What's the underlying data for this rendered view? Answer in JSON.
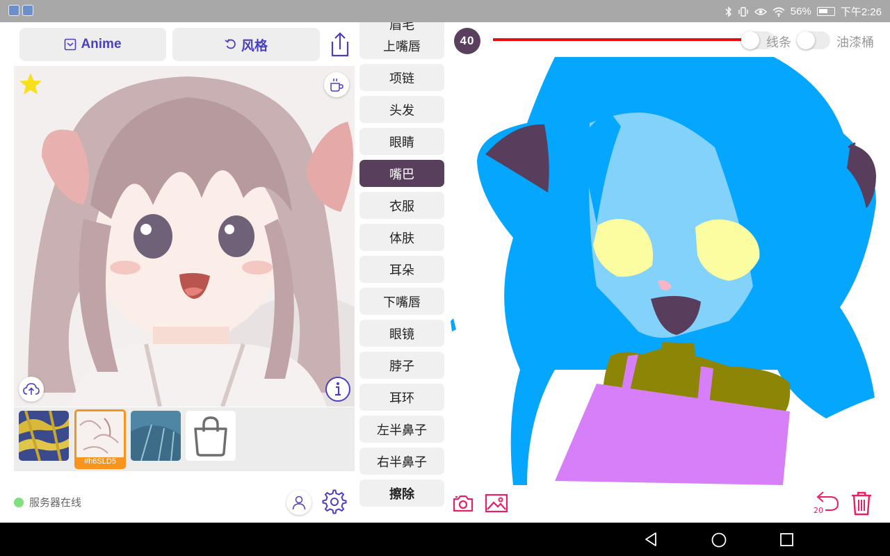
{
  "status_bar": {
    "battery": "56%",
    "time": "下午2:26"
  },
  "header": {
    "model_button": "Anime",
    "style_button": "风格"
  },
  "thumbnails": {
    "selected_label": "#h6SLD5"
  },
  "footer": {
    "server_status": "服务器在线"
  },
  "labels": {
    "partial_top": "眉毛",
    "items": [
      "上嘴唇",
      "项链",
      "头发",
      "眼睛",
      "嘴巴",
      "衣服",
      "体肤",
      "耳朵",
      "下嘴唇",
      "眼镜",
      "脖子",
      "耳环",
      "左半鼻子",
      "右半鼻子",
      "擦除"
    ],
    "selected": "嘴巴"
  },
  "drawing": {
    "brush_size": "40",
    "toggle_line": "线条",
    "toggle_bucket": "油漆桶",
    "undo_count": "20",
    "accent": "#e91e63",
    "slider_color": "#ee0b0b"
  }
}
